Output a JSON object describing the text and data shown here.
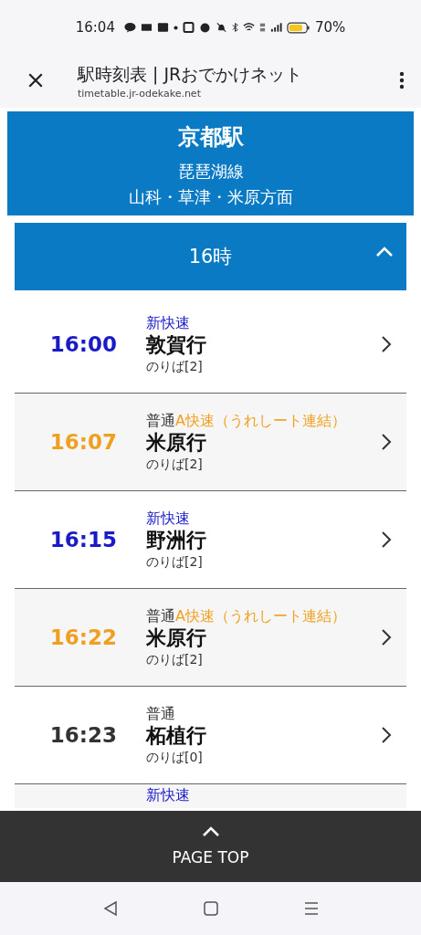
{
  "status_bar": {
    "time": "16:04",
    "battery": "70%"
  },
  "browser": {
    "title": "駅時刻表 | JRおでかけネット",
    "url": "timetable.jr-odekake.net"
  },
  "station": {
    "name": "京都駅",
    "line": "琵琶湖線",
    "direction": "山科・草津・米原方面"
  },
  "hour": {
    "label": "16時",
    "expanded": true
  },
  "trains": [
    {
      "time": "16:00",
      "kind": "special-rapid",
      "service": [
        {
          "text": "新快速",
          "kind": "special-rapid"
        }
      ],
      "destination": "敦賀行",
      "platform": "のりば[2]"
    },
    {
      "time": "16:07",
      "kind": "a-rapid",
      "service": [
        {
          "text": "普通",
          "kind": "local"
        },
        {
          "text": "A快速（うれしート連結）",
          "kind": "a-rapid"
        }
      ],
      "destination": "米原行",
      "platform": "のりば[2]"
    },
    {
      "time": "16:15",
      "kind": "special-rapid",
      "service": [
        {
          "text": "新快速",
          "kind": "special-rapid"
        }
      ],
      "destination": "野洲行",
      "platform": "のりば[2]"
    },
    {
      "time": "16:22",
      "kind": "a-rapid",
      "service": [
        {
          "text": "普通",
          "kind": "local"
        },
        {
          "text": "A快速（うれしート連結）",
          "kind": "a-rapid"
        }
      ],
      "destination": "米原行",
      "platform": "のりば[2]"
    },
    {
      "time": "16:23",
      "kind": "local",
      "service": [
        {
          "text": "普通",
          "kind": "local"
        }
      ],
      "destination": "柘植行",
      "platform": "のりば[0]"
    }
  ],
  "partial_train": {
    "service": [
      {
        "text": "新快速",
        "kind": "special-rapid"
      }
    ]
  },
  "page_top": {
    "label": "PAGE TOP"
  }
}
